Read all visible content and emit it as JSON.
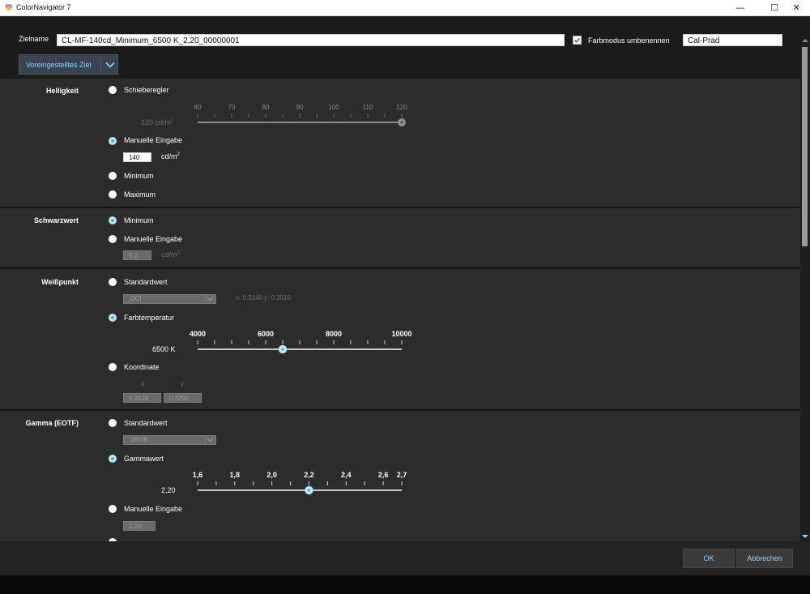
{
  "window": {
    "title": "ColorNavigator 7",
    "minimize": "—",
    "maximize": "☐",
    "close": "✕"
  },
  "header": {
    "target_name_label": "Zielname",
    "target_name_value": "CL-MF-140cd_Minimum_6500 K_2,20_00000001",
    "rename_checkbox_checked": true,
    "rename_label": "Farbmodus umbenennen",
    "color_mode_value": "Cal-Prad",
    "preset_button": "Voreingestelltes Ziel"
  },
  "brightness": {
    "title": "Helligkeit",
    "opt_slider": "Schieberegler",
    "slider_ticks": [
      "60",
      "70",
      "80",
      "90",
      "100",
      "110",
      "120"
    ],
    "slider_value_label": "120 cd/m",
    "slider_value": 120,
    "slider_min": 60,
    "slider_max": 120,
    "opt_manual": "Manuelle Eingabe",
    "manual_value": "140",
    "unit": "cd/m",
    "unit_sup": "2",
    "opt_min": "Minimum",
    "opt_max": "Maximum",
    "selected": "manual"
  },
  "black": {
    "title": "Schwarzwert",
    "opt_min": "Minimum",
    "opt_manual": "Manuelle Eingabe",
    "manual_value": "0,2",
    "unit": "cd/m",
    "unit_sup": "2",
    "selected": "min"
  },
  "white": {
    "title": "Weißpunkt",
    "opt_standard": "Standardwert",
    "standard_dropdown": "DCI",
    "xy_readout": "x: 0,3140  y: 0,3510",
    "opt_temp": "Farbtemperatur",
    "temp_ticks": [
      "4000",
      "6000",
      "8000",
      "10000"
    ],
    "temp_value_label": "6500 K",
    "temp_value": 6500,
    "temp_min": 4000,
    "temp_max": 10000,
    "opt_coord": "Koordinate",
    "coord_x_label": "x",
    "coord_y_label": "y",
    "coord_x": "0,3128",
    "coord_y": "0,3292",
    "selected": "temp"
  },
  "gamma": {
    "title": "Gamma (EOTF)",
    "opt_standard": "Standardwert",
    "standard_dropdown": "sRGB",
    "opt_gamma": "Gammawert",
    "gamma_ticks": [
      "1,6",
      "1,8",
      "2,0",
      "2,2",
      "2,4",
      "2,6",
      "2,7"
    ],
    "gamma_value_label": "2,20",
    "gamma_value": 2.2,
    "gamma_min": 1.6,
    "gamma_max": 2.7,
    "opt_manual": "Manuelle Eingabe",
    "manual_value": "2,20",
    "selected": "gamma"
  },
  "footer": {
    "ok": "OK",
    "cancel": "Abbrechen"
  },
  "colors": {
    "accent": "#3fa8e8",
    "button_text": "#8fd0ff",
    "panel": "#2c2c2c"
  }
}
